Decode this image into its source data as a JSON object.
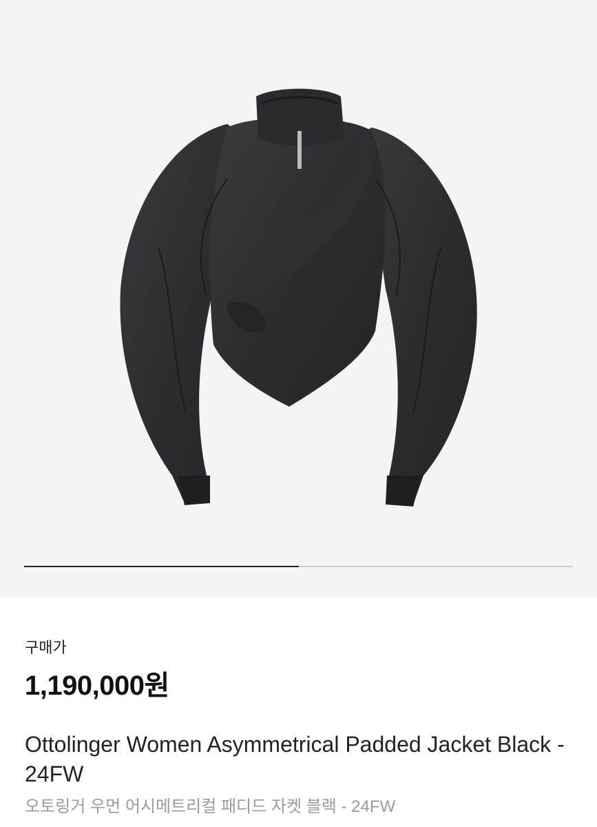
{
  "gallery": {
    "image_subject": "black asymmetrical padded jacket",
    "background_color": "#f4f4f4",
    "progress": 0.5,
    "progress_color": "#222222",
    "track_color": "#cfcfcf"
  },
  "product": {
    "price_label": "구매가",
    "price": "1,190,000원",
    "title_en": "Ottolinger Women Asymmetrical Padded Jacket Black - 24FW",
    "title_ko": "오토링거 우먼 어시메트리컬 패디드 자켓 블랙 - 24FW"
  }
}
